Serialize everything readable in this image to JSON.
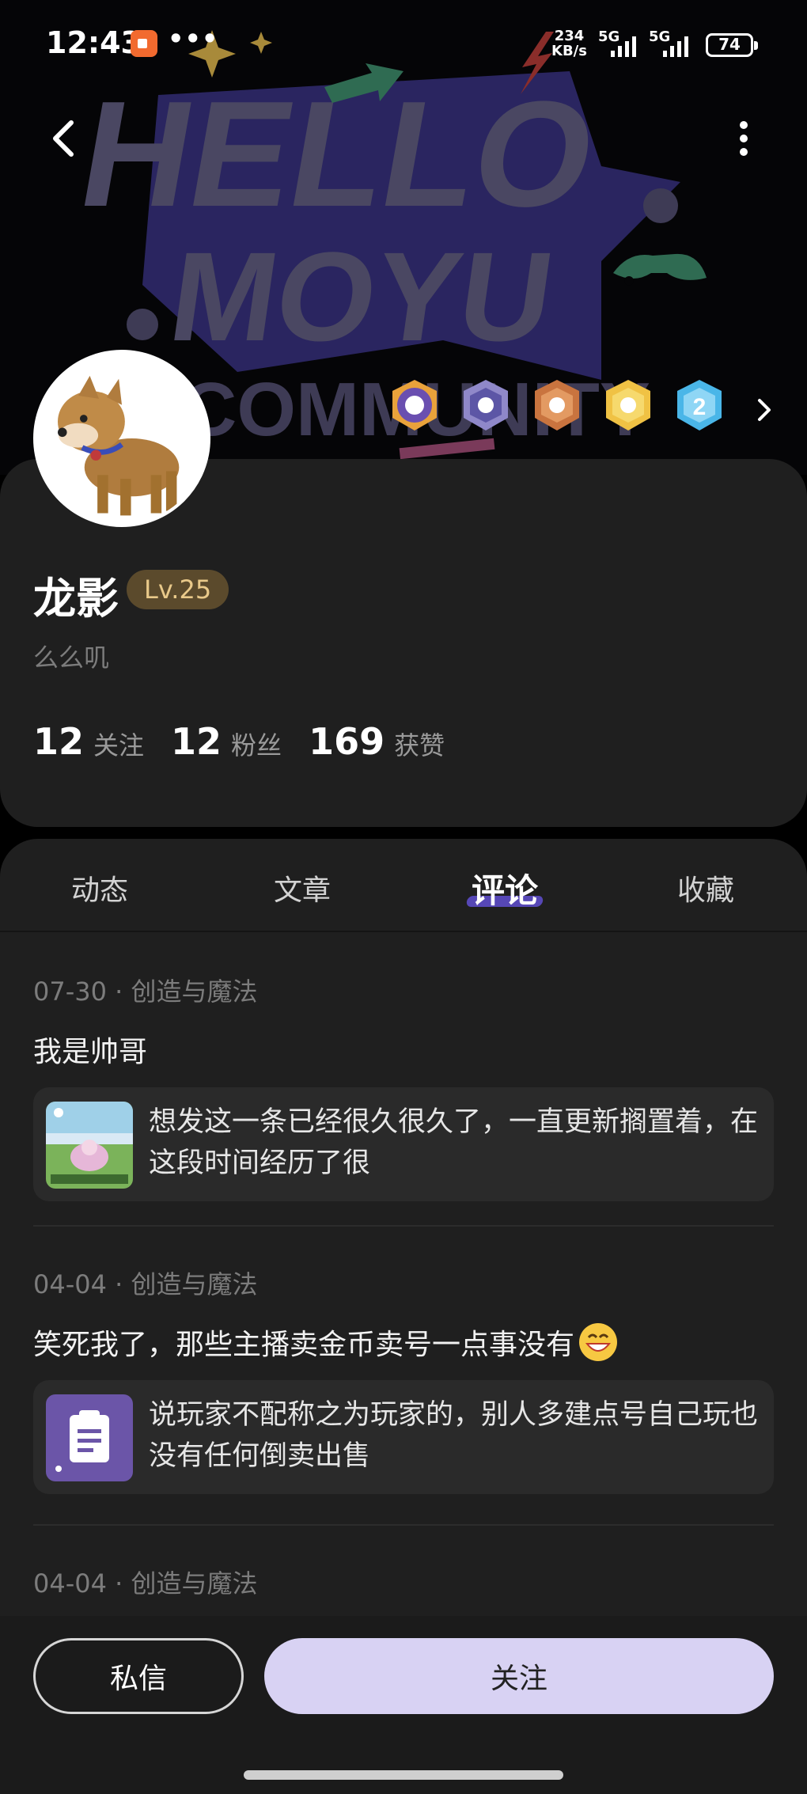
{
  "status_bar": {
    "time": "12:43",
    "dots": "•••",
    "speed_value": "234",
    "speed_unit": "KB/s",
    "net1": "5G",
    "net2": "5G",
    "battery": "74"
  },
  "banner": {
    "line1": "HELLO",
    "line2": "MOYU",
    "line3": "COMMUNITY"
  },
  "profile": {
    "username": "龙影",
    "level": "Lv.25",
    "bio": "么么叽",
    "stats": [
      {
        "num": "12",
        "label": "关注"
      },
      {
        "num": "12",
        "label": "粉丝"
      },
      {
        "num": "169",
        "label": "获赞"
      }
    ]
  },
  "badges": [
    "purple-shield-badge",
    "silver-badge",
    "bronze-badge",
    "gold-badge",
    "blue-number-2-badge"
  ],
  "tabs": [
    {
      "label": "动态"
    },
    {
      "label": "文章"
    },
    {
      "label": "评论"
    },
    {
      "label": "收藏"
    }
  ],
  "active_tab": "评论",
  "comments": [
    {
      "meta": "07-30 · 创造与魔法",
      "text": "我是帅哥",
      "quote": "想发这一条已经很久很久了，一直更新搁置着，在这段时间经历了很"
    },
    {
      "meta": "04-04 · 创造与魔法",
      "text": "笑死我了，那些主播卖金币卖号一点事没有",
      "quote": "说玩家不配称之为玩家的，别人多建点号自己玩也没有任何倒卖出售"
    },
    {
      "meta": "04-04 · 创造与魔法"
    }
  ],
  "actions": {
    "message": "私信",
    "follow": "关注"
  },
  "colors": {
    "card_bg": "#1f1f1f",
    "accent": "#5647b6",
    "follow_bg": "#d8d2f3",
    "level_bg": "#5b4a2c",
    "level_text": "#e9c98a"
  }
}
